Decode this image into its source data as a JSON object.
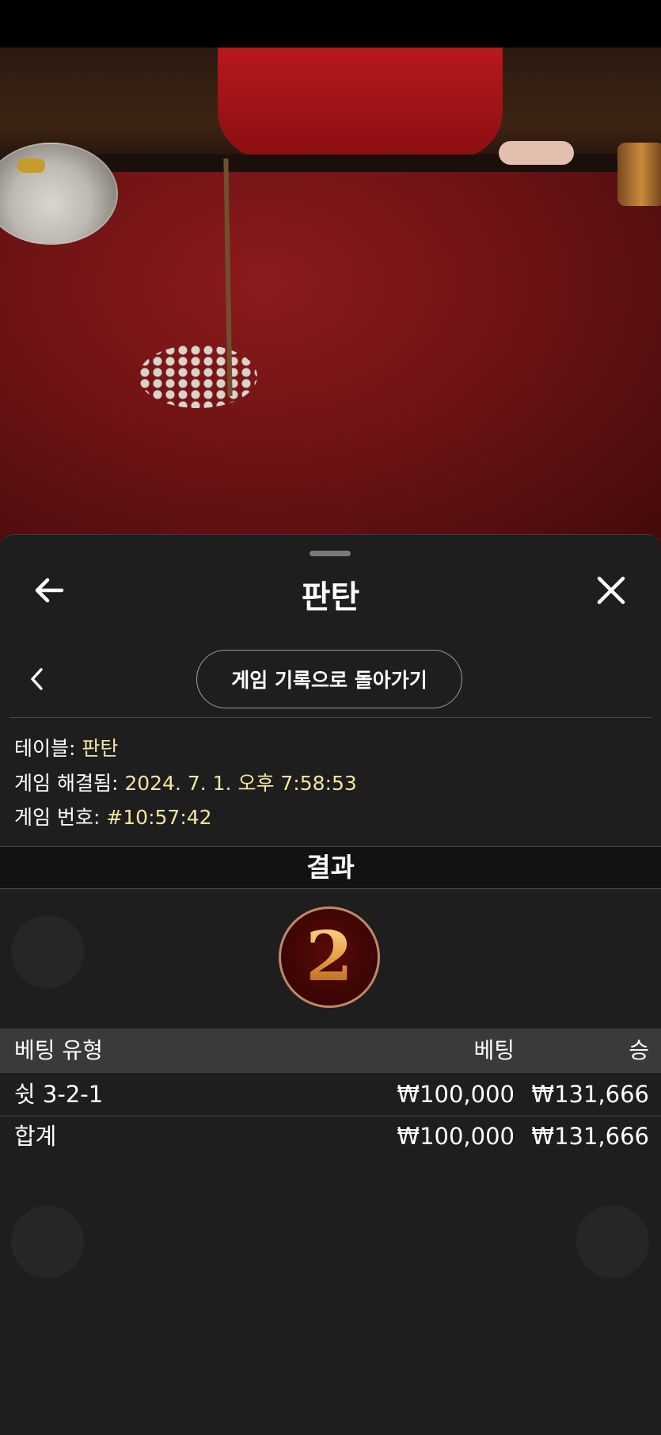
{
  "sheet": {
    "title": "판탄",
    "back_link_label": "게임 기록으로 돌아가기"
  },
  "info": {
    "table_label": "테이블: ",
    "table_value": "판탄",
    "resolved_label": "게임 해결됨: ",
    "resolved_value": "2024. 7. 1. 오후 7:58:53",
    "game_no_label": "게임 번호: ",
    "game_no_value": "#10:57:42"
  },
  "result": {
    "header": "결과",
    "number": "2"
  },
  "bets_table": {
    "headers": [
      "베팅 유형",
      "베팅",
      "승"
    ],
    "rows": [
      {
        "type": "쉿 3-2-1",
        "bet": "₩100,000",
        "win": "₩131,666"
      }
    ],
    "total": {
      "label": "합계",
      "bet": "₩100,000",
      "win": "₩131,666"
    }
  },
  "icons": [
    "back-arrow-icon",
    "close-icon",
    "chevron-left-icon"
  ],
  "colors": {
    "accent_value": "#f3e3a6",
    "sheet_bg": "#1e1e1e",
    "header_row_bg": "#3a3a3a"
  }
}
